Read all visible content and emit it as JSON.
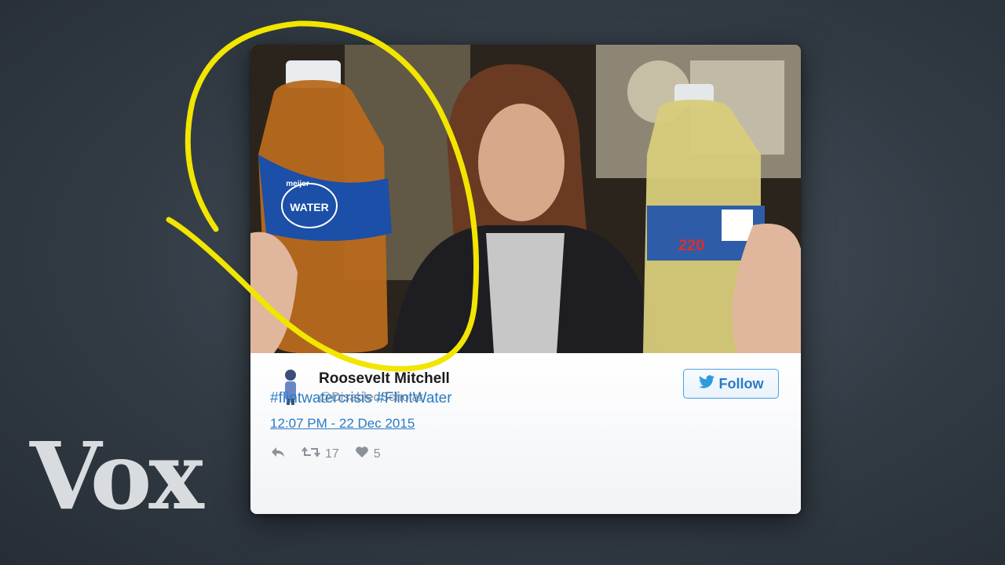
{
  "brand": {
    "logo_text": "Vox"
  },
  "tweet": {
    "author_name": "Roosevelt Mitchell",
    "author_handle": "@DisabledScholar",
    "follow_label": "Follow",
    "text": "#flintwatercrisis #FlintWater",
    "timestamp": "12:07 PM - 22 Dec 2015",
    "retweet_count": "17",
    "like_count": "5"
  },
  "photo": {
    "left_bottle_label": "WATER",
    "left_bottle_brand": "meijer",
    "right_bottle_writing": "220"
  },
  "colors": {
    "twitter_blue": "#2b7bc4",
    "highlight_yellow": "#f2e500",
    "background": "#323b44"
  },
  "icons": {
    "reply": "reply-icon",
    "retweet": "retweet-icon",
    "like": "heart-icon",
    "twitter": "twitter-bird-icon"
  }
}
